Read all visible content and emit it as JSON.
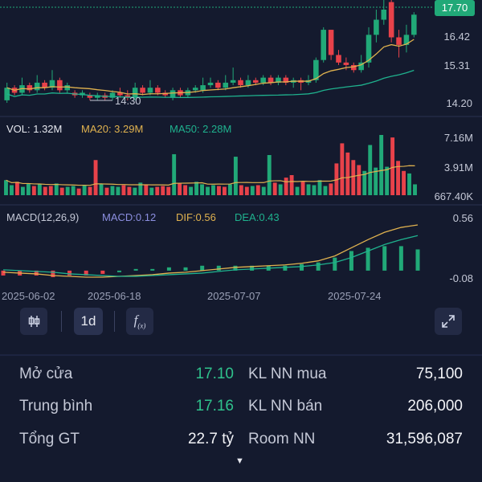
{
  "chart": {
    "current_price": "17.70",
    "price_axis": [
      "16.42",
      "15.31",
      "14.20"
    ],
    "low_marker": "14.30",
    "volume": {
      "vol_label": "VOL: 1.32M",
      "ma20_label": "MA20: 3.29M",
      "ma50_label": "MA50: 2.28M",
      "axis": [
        "7.16M",
        "3.91M",
        "667.40K"
      ]
    },
    "macd": {
      "title": "MACD(12,26,9)",
      "macd_label": "MACD:0.12",
      "dif_label": "DIF:0.56",
      "dea_label": "DEA:0.43",
      "axis": [
        "0.56",
        "-0.08"
      ]
    },
    "dates": [
      "2025-06-02",
      "2025-06-18",
      "2025-07-07",
      "2025-07-24"
    ],
    "colors": {
      "up": "#21a978",
      "down": "#e8424a",
      "ma_short": "#e0b24f",
      "ma_long": "#1fb28e",
      "macd_bar_up": "#21a978",
      "macd_bar_down": "#e8424a"
    }
  },
  "chart_data": {
    "type": "candlestick",
    "candles": [
      {
        "o": 14.3,
        "c": 14.8,
        "h": 15.0,
        "l": 14.2
      },
      {
        "o": 14.8,
        "c": 14.6,
        "h": 14.9,
        "l": 14.5
      },
      {
        "o": 14.6,
        "c": 14.9,
        "h": 15.2,
        "l": 14.5
      },
      {
        "o": 14.9,
        "c": 14.7,
        "h": 15.0,
        "l": 14.6
      },
      {
        "o": 14.7,
        "c": 15.0,
        "h": 15.3,
        "l": 14.6
      },
      {
        "o": 15.0,
        "c": 14.8,
        "h": 15.1,
        "l": 14.7
      },
      {
        "o": 14.8,
        "c": 15.1,
        "h": 15.5,
        "l": 14.7
      },
      {
        "o": 15.1,
        "c": 14.7,
        "h": 15.2,
        "l": 14.6
      },
      {
        "o": 14.7,
        "c": 14.9,
        "h": 15.0,
        "l": 14.6
      },
      {
        "o": 14.6,
        "c": 14.5,
        "h": 14.7,
        "l": 14.4
      },
      {
        "o": 14.5,
        "c": 14.6,
        "h": 14.7,
        "l": 14.4
      },
      {
        "o": 14.5,
        "c": 14.4,
        "h": 14.6,
        "l": 14.3
      },
      {
        "o": 14.4,
        "c": 14.5,
        "h": 14.6,
        "l": 14.3
      },
      {
        "o": 14.5,
        "c": 14.4,
        "h": 14.6,
        "l": 14.3
      },
      {
        "o": 14.4,
        "c": 14.6,
        "h": 14.7,
        "l": 14.3
      },
      {
        "o": 14.6,
        "c": 14.5,
        "h": 14.8,
        "l": 14.4
      },
      {
        "o": 14.5,
        "c": 14.4,
        "h": 14.7,
        "l": 14.3
      },
      {
        "o": 14.4,
        "c": 14.8,
        "h": 15.0,
        "l": 14.3
      },
      {
        "o": 14.8,
        "c": 14.6,
        "h": 14.9,
        "l": 14.5
      },
      {
        "o": 14.6,
        "c": 14.8,
        "h": 15.1,
        "l": 14.5
      },
      {
        "o": 14.8,
        "c": 14.6,
        "h": 14.9,
        "l": 14.5
      },
      {
        "o": 14.6,
        "c": 14.5,
        "h": 14.7,
        "l": 14.4
      },
      {
        "o": 14.4,
        "c": 14.7,
        "h": 14.8,
        "l": 14.3
      },
      {
        "o": 14.7,
        "c": 14.5,
        "h": 14.8,
        "l": 14.4
      },
      {
        "o": 14.5,
        "c": 14.7,
        "h": 14.8,
        "l": 14.4
      },
      {
        "o": 14.7,
        "c": 14.8,
        "h": 14.9,
        "l": 14.6
      },
      {
        "o": 14.7,
        "c": 14.9,
        "h": 15.2,
        "l": 14.6
      },
      {
        "o": 14.9,
        "c": 15.0,
        "h": 15.2,
        "l": 14.8
      },
      {
        "o": 15.0,
        "c": 14.8,
        "h": 15.1,
        "l": 14.7
      },
      {
        "o": 14.8,
        "c": 15.0,
        "h": 15.3,
        "l": 14.7
      },
      {
        "o": 15.0,
        "c": 15.1,
        "h": 15.6,
        "l": 14.9
      },
      {
        "o": 15.1,
        "c": 14.9,
        "h": 15.2,
        "l": 14.8
      },
      {
        "o": 14.9,
        "c": 15.1,
        "h": 15.3,
        "l": 14.8
      },
      {
        "o": 15.1,
        "c": 15.0,
        "h": 15.2,
        "l": 14.9
      },
      {
        "o": 15.0,
        "c": 15.2,
        "h": 15.3,
        "l": 14.9
      },
      {
        "o": 15.2,
        "c": 15.0,
        "h": 15.3,
        "l": 14.9
      },
      {
        "o": 15.0,
        "c": 15.2,
        "h": 15.3,
        "l": 14.9
      },
      {
        "o": 15.2,
        "c": 15.0,
        "h": 15.3,
        "l": 14.9
      },
      {
        "o": 15.0,
        "c": 15.1,
        "h": 15.2,
        "l": 14.8
      },
      {
        "o": 15.1,
        "c": 15.0,
        "h": 15.2,
        "l": 14.7
      },
      {
        "o": 15.0,
        "c": 15.1,
        "h": 15.3,
        "l": 14.9
      },
      {
        "o": 15.1,
        "c": 15.9,
        "h": 16.0,
        "l": 15.0
      },
      {
        "o": 15.9,
        "c": 17.1,
        "h": 17.2,
        "l": 15.8
      },
      {
        "o": 17.1,
        "c": 16.1,
        "h": 17.1,
        "l": 15.9
      },
      {
        "o": 16.1,
        "c": 15.8,
        "h": 16.3,
        "l": 15.7
      },
      {
        "o": 15.8,
        "c": 15.7,
        "h": 16.0,
        "l": 15.5
      },
      {
        "o": 15.7,
        "c": 15.5,
        "h": 15.8,
        "l": 15.4
      },
      {
        "o": 15.5,
        "c": 15.8,
        "h": 16.1,
        "l": 15.4
      },
      {
        "o": 15.8,
        "c": 16.9,
        "h": 17.2,
        "l": 15.6
      },
      {
        "o": 16.9,
        "c": 17.5,
        "h": 17.9,
        "l": 16.6
      },
      {
        "o": 17.5,
        "c": 17.9,
        "h": 18.4,
        "l": 17.3
      },
      {
        "o": 18.2,
        "c": 16.8,
        "h": 18.4,
        "l": 16.6
      },
      {
        "o": 16.8,
        "c": 16.5,
        "h": 17.1,
        "l": 16.0
      },
      {
        "o": 16.5,
        "c": 16.9,
        "h": 17.3,
        "l": 16.2
      },
      {
        "o": 16.9,
        "c": 17.7,
        "h": 17.8,
        "l": 16.8
      }
    ],
    "volume": [
      1.8,
      1.2,
      1.6,
      1.0,
      1.4,
      1.1,
      1.3,
      1.0,
      1.1,
      1.4,
      0.9,
      1.0,
      1.1,
      0.8,
      1.2,
      1.0,
      4.2,
      1.3,
      0.9,
      1.1,
      1.0,
      1.2,
      1.0,
      0.9,
      1.5,
      1.2,
      0.9,
      1.0,
      1.1,
      1.0,
      4.9,
      1.4,
      1.2,
      1.0,
      1.6,
      1.3,
      1.0,
      1.2,
      1.1,
      1.0,
      1.3,
      4.6,
      1.2,
      1.0,
      1.1,
      1.2,
      1.0,
      4.8,
      1.5,
      1.3,
      2.1,
      2.4,
      1.0,
      1.6,
      1.3,
      1.2,
      1.8,
      1.1,
      1.4,
      3.8,
      6.2,
      5.1,
      4.2,
      3.6,
      2.9,
      6.0,
      3.3,
      7.2,
      3.4,
      6.9,
      4.1,
      2.9,
      2.6,
      1.3
    ],
    "volume_unit": "M",
    "macd_dif": [
      -0.02,
      -0.03,
      -0.04,
      -0.06,
      -0.07,
      -0.08,
      -0.08,
      -0.07,
      -0.06,
      -0.05,
      -0.03,
      -0.02,
      0.0,
      0.02,
      0.04,
      0.05,
      0.06,
      0.07,
      0.09,
      0.12,
      0.18,
      0.28,
      0.38,
      0.47,
      0.53,
      0.56
    ],
    "macd_dea": [
      0.01,
      0.0,
      -0.01,
      -0.02,
      -0.04,
      -0.05,
      -0.06,
      -0.07,
      -0.07,
      -0.06,
      -0.05,
      -0.04,
      -0.03,
      -0.01,
      0.01,
      0.02,
      0.03,
      0.04,
      0.05,
      0.07,
      0.1,
      0.16,
      0.24,
      0.32,
      0.38,
      0.43
    ],
    "ylim_price": [
      14.2,
      17.9
    ],
    "ylim_macd": [
      -0.08,
      0.56
    ]
  },
  "toolbar": {
    "candle_type_icon": "candlestick-icon",
    "interval_label": "1d",
    "indicator_icon": "function-icon",
    "fullscreen_icon": "expand-icon"
  },
  "info": {
    "rows": [
      {
        "label": "Mở cửa",
        "value": "17.10",
        "label2": "KL NN mua",
        "value2": "75,100"
      },
      {
        "label": "Trung bình",
        "value": "17.16",
        "label2": "KL NN bán",
        "value2": "206,000"
      },
      {
        "label": "Tổng GT",
        "value": "22.7 tỷ",
        "label2": "Room NN",
        "value2": "31,596,087"
      }
    ],
    "more_icon": "caret-down-icon"
  }
}
